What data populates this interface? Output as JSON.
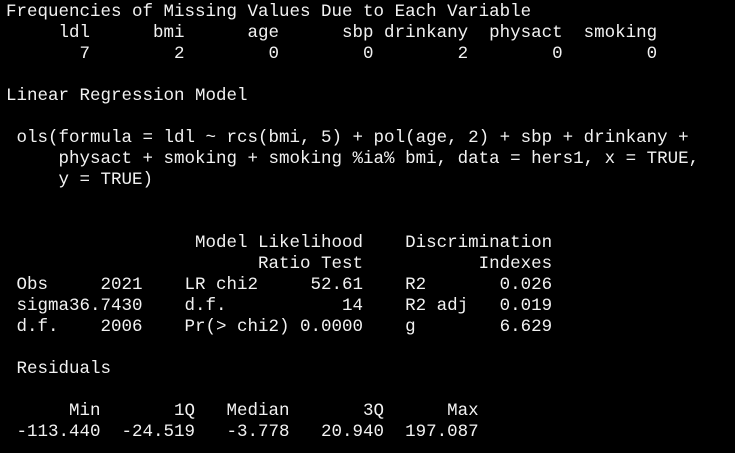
{
  "theme": {
    "background": "#000000",
    "text": "#f2f2f2"
  },
  "console": {
    "lines": [
      "Frequencies of Missing Values Due to Each Variable",
      "     ldl      bmi      age      sbp drinkany  physact  smoking",
      "       7        2        0        0        2        0        0",
      "",
      "Linear Regression Model",
      "",
      " ols(formula = ldl ~ rcs(bmi, 5) + pol(age, 2) + sbp + drinkany +",
      "     physact + smoking + smoking %ia% bmi, data = hers1, x = TRUE,",
      "     y = TRUE)",
      "",
      "",
      "                  Model Likelihood    Discrimination",
      "                        Ratio Test           Indexes",
      " Obs     2021    LR chi2     52.61    R2       0.026",
      " sigma36.7430    d.f.           14    R2 adj   0.019",
      " d.f.    2006    Pr(> chi2) 0.0000    g        6.629",
      "",
      " Residuals",
      "",
      "      Min       1Q   Median       3Q      Max",
      " -113.440  -24.519   -3.778   20.940  197.087"
    ]
  }
}
